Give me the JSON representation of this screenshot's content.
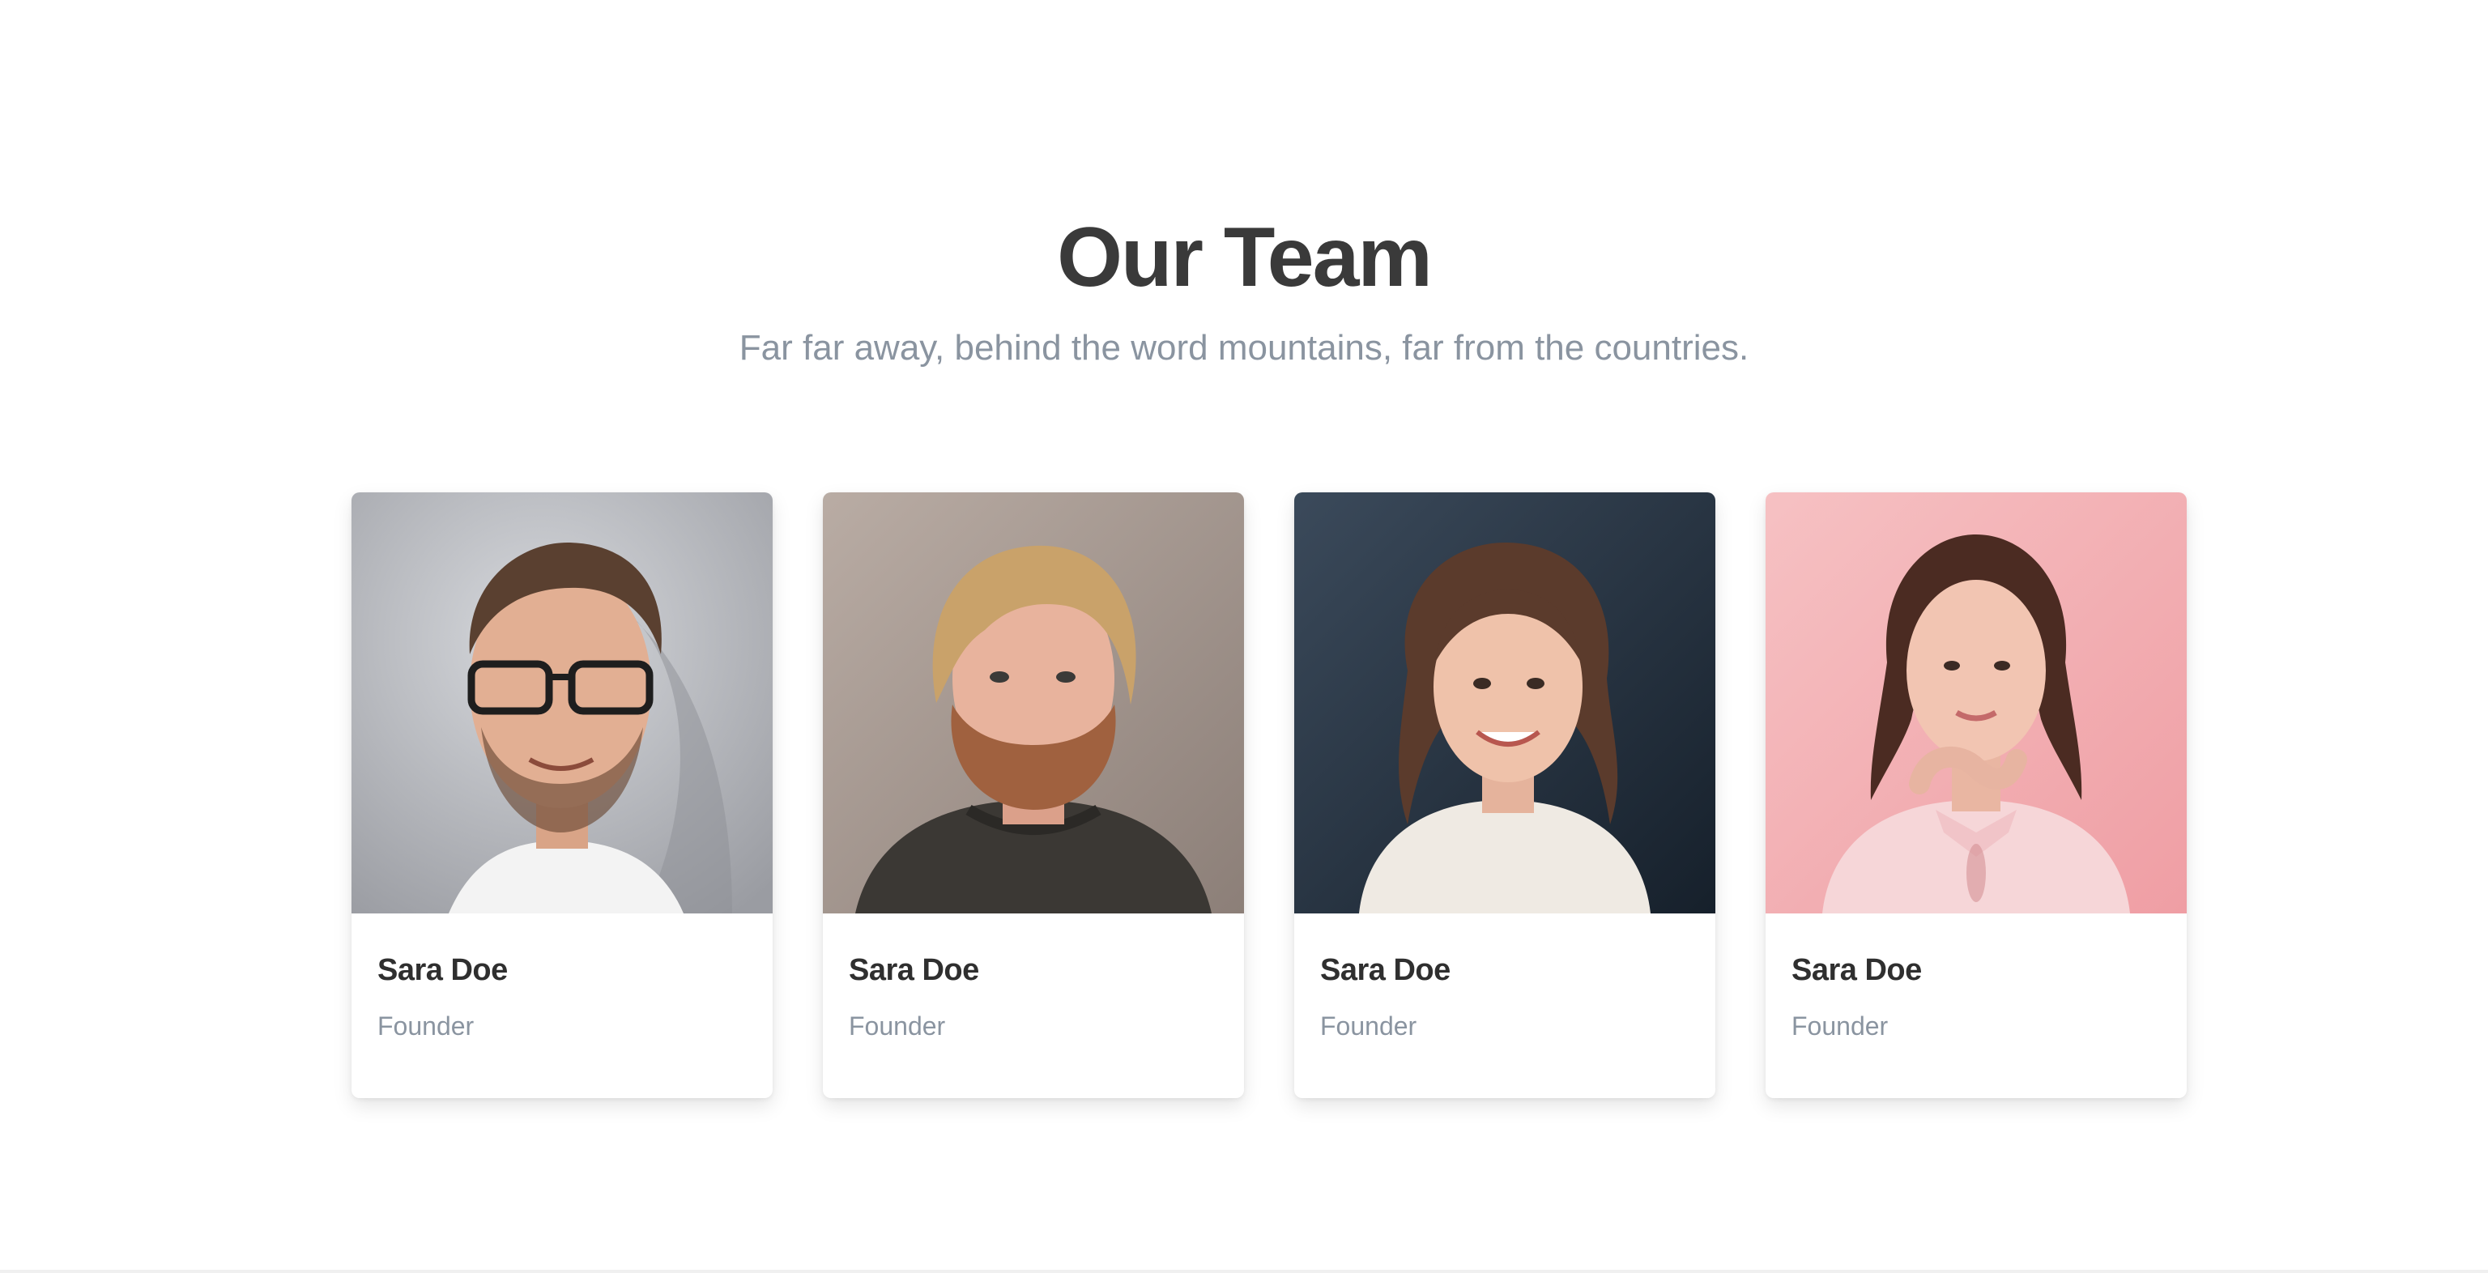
{
  "section": {
    "title": "Our Team",
    "subtitle": "Far far away, behind the word mountains, far from the countries."
  },
  "team": [
    {
      "name": "Sara Doe",
      "role": "Founder",
      "photo": "portrait-man-glasses"
    },
    {
      "name": "Sara Doe",
      "role": "Founder",
      "photo": "portrait-man-beard"
    },
    {
      "name": "Sara Doe",
      "role": "Founder",
      "photo": "portrait-woman-curly-hair"
    },
    {
      "name": "Sara Doe",
      "role": "Founder",
      "photo": "portrait-woman-pink-background"
    }
  ],
  "colors": {
    "title": "#3a3a3a",
    "subtitle": "#8a94a0",
    "card_background": "#ffffff",
    "photo1_background": "#bfc1c6",
    "photo2_background": "#a89a91",
    "photo3_background": "#2c3b4a",
    "photo4_background": "#f2b3b6"
  }
}
